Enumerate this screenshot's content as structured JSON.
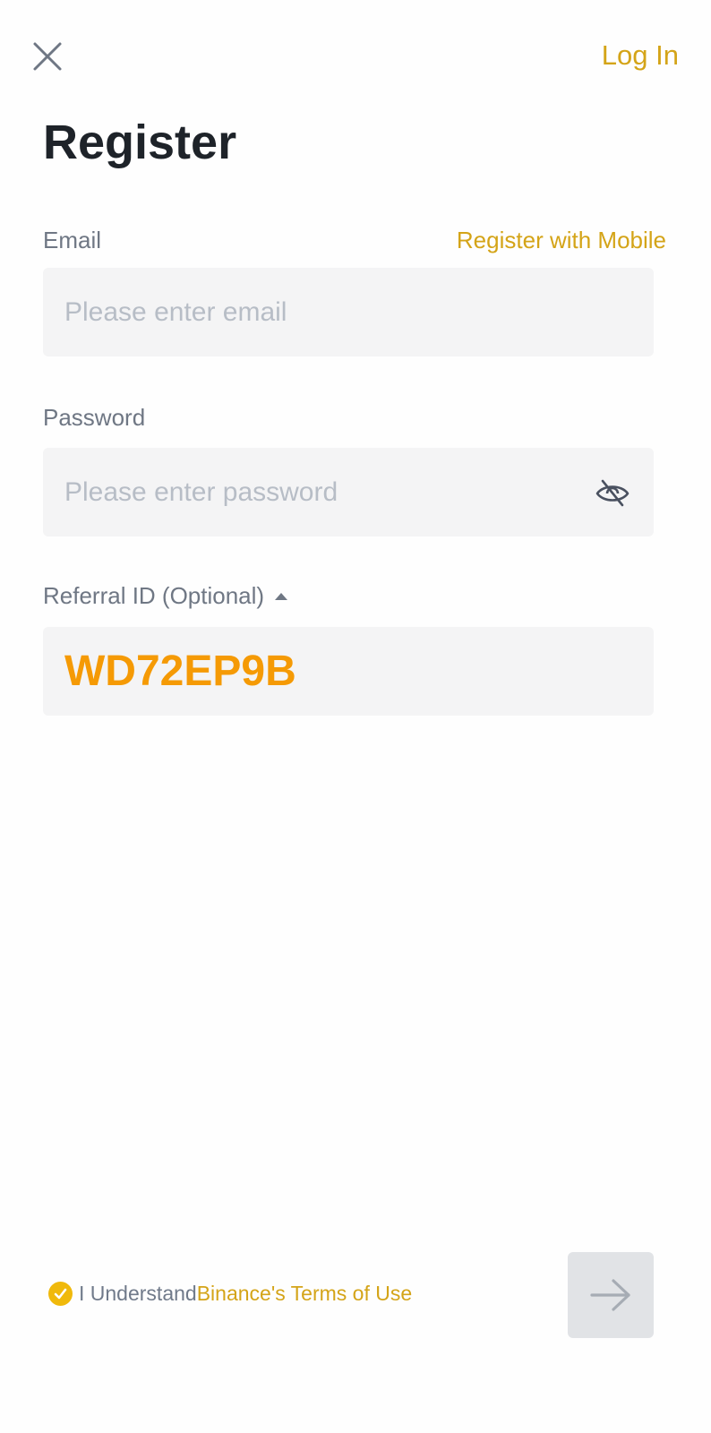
{
  "header": {
    "login_label": "Log In",
    "close_icon": "close-icon"
  },
  "title": "Register",
  "email": {
    "label": "Email",
    "switch_label": "Register with Mobile",
    "placeholder": "Please enter email",
    "value": ""
  },
  "password": {
    "label": "Password",
    "placeholder": "Please enter password",
    "value": "",
    "toggle_icon": "eye-off-icon"
  },
  "referral": {
    "label": "Referral ID (Optional)",
    "value": "WD72EP9B",
    "toggle_icon": "caret-up-icon"
  },
  "terms": {
    "prefix": "I Understand",
    "link": "Binance's Terms of Use",
    "checked": true
  },
  "next_icon": "arrow-right-icon",
  "colors": {
    "accent": "#d4a418",
    "check": "#f0b90b",
    "referral_value": "#f59a05",
    "field_bg": "#f4f4f5",
    "button_disabled": "#e1e3e6"
  }
}
